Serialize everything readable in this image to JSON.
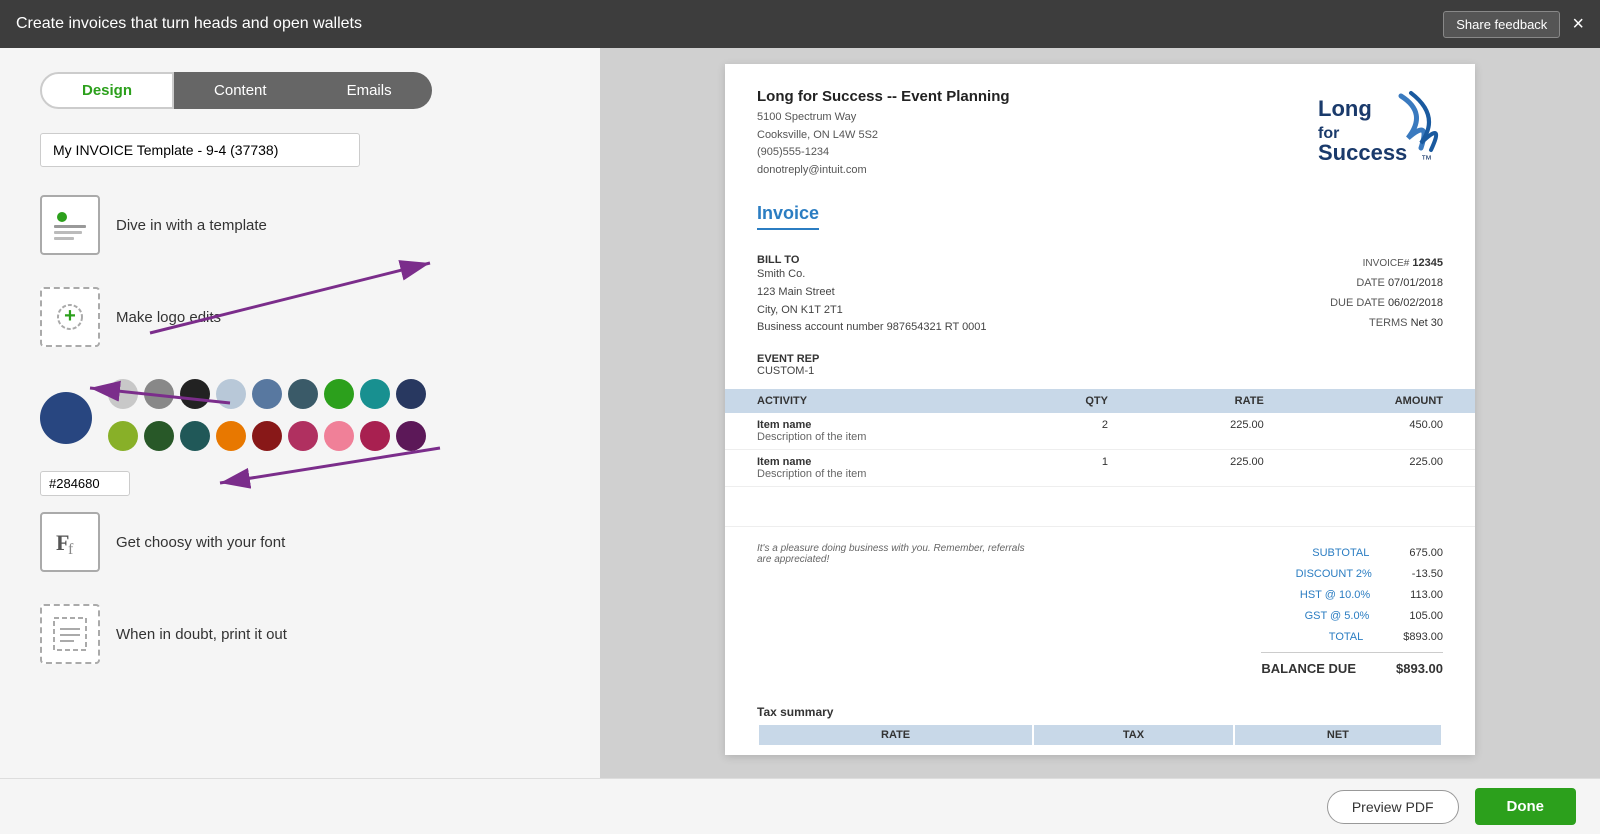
{
  "header": {
    "title": "Create invoices that turn heads and open wallets",
    "share_feedback_label": "Share feedback",
    "close_label": "×"
  },
  "tabs": {
    "design": "Design",
    "content": "Content",
    "emails": "Emails"
  },
  "template_name": "My INVOICE Template - 9-4 (37738)",
  "features": [
    {
      "id": "template",
      "label": "Dive in with a template"
    },
    {
      "id": "logo",
      "label": "Make logo edits"
    },
    {
      "id": "font",
      "label": "Get choosy with your font"
    },
    {
      "id": "print",
      "label": "When in doubt, print it out"
    }
  ],
  "colors": {
    "selected": "#284680",
    "selected_hex": "#284680",
    "swatches_row1": [
      "#c8c8c8",
      "#888888",
      "#222222",
      "#b8c8d8",
      "#5878a0",
      "#3a5a68",
      "#2ca01c",
      "#189090",
      "#283860"
    ],
    "swatches_row2": [
      "#88b028",
      "#285828",
      "#205858",
      "#e87800",
      "#881818",
      "#b03060",
      "#f08098",
      "#a82050",
      "#5c1858"
    ]
  },
  "invoice": {
    "company_name": "Long for Success -- Event Planning",
    "address_line1": "5100 Spectrum Way",
    "address_line2": "Cooksville, ON L4W 5S2",
    "phone": "(905)555-1234",
    "email": "donotreply@intuit.com",
    "logo_text": "Long for Success",
    "invoice_label": "Invoice",
    "bill_to_label": "BILL TO",
    "bill_to_name": "Smith Co.",
    "bill_to_address1": "123 Main Street",
    "bill_to_city": "City, ON K1T 2T1",
    "bill_to_account": "Business account number  987654321 RT 0001",
    "invoice_number_label": "INVOICE#",
    "invoice_number": "12345",
    "date_label": "DATE",
    "date_value": "07/01/2018",
    "due_date_label": "DUE DATE",
    "due_date_value": "06/02/2018",
    "terms_label": "TERMS",
    "terms_value": "Net 30",
    "event_rep_label": "EVENT REP",
    "event_rep_value": "CUSTOM-1",
    "table_headers": [
      "ACTIVITY",
      "QTY",
      "RATE",
      "AMOUNT"
    ],
    "line_items": [
      {
        "name": "Item name",
        "desc": "Description of the item",
        "qty": "2",
        "rate": "225.00",
        "amount": "450.00"
      },
      {
        "name": "Item name",
        "desc": "Description of the item",
        "qty": "1",
        "rate": "225.00",
        "amount": "225.00"
      }
    ],
    "footer_note": "It's a pleasure doing business with you. Remember, referrals are appreciated!",
    "subtotal_label": "SUBTOTAL",
    "subtotal_value": "675.00",
    "discount_label": "DISCOUNT 2%",
    "discount_value": "-13.50",
    "hst_label": "HST @ 10.0%",
    "hst_value": "113.00",
    "gst_label": "GST @ 5.0%",
    "gst_value": "105.00",
    "total_label": "TOTAL",
    "total_value": "$893.00",
    "balance_due_label": "BALANCE DUE",
    "balance_due_value": "$893.00",
    "tax_summary_label": "Tax summary",
    "tax_col_rate": "RATE",
    "tax_col_tax": "TAX",
    "tax_col_net": "NET"
  },
  "footer": {
    "preview_pdf_label": "Preview PDF",
    "done_label": "Done"
  }
}
